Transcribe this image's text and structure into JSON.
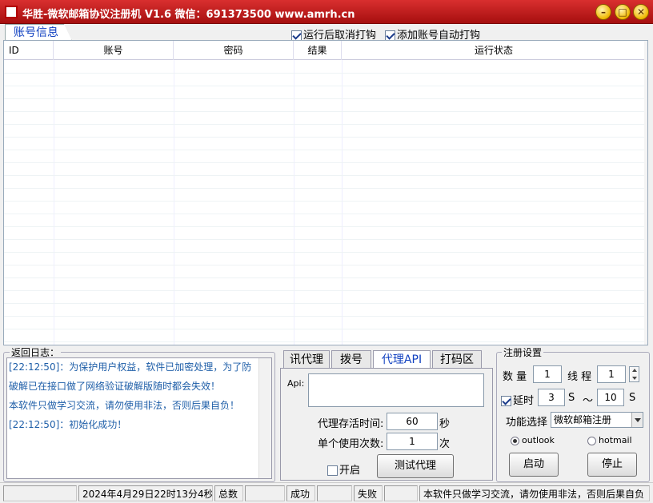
{
  "window": {
    "title": "华胜-微软邮箱协议注册机 V1.6  微信：691373500  www.amrh.cn",
    "minimize": "–",
    "maximize": "□",
    "close": "✕"
  },
  "tabs": {
    "account_info": "账号信息"
  },
  "options": {
    "uncheck_after_run": {
      "label": "运行后取消打钩",
      "checked": true
    },
    "auto_check_new": {
      "label": "添加账号自动打钩",
      "checked": true
    }
  },
  "table": {
    "columns": [
      "ID",
      "账号",
      "密码",
      "结果",
      "运行状态"
    ],
    "rows": []
  },
  "log": {
    "title": "返回日志：",
    "lines": [
      "[22:12:50]：为保护用户权益，软件已加密处理，为了防",
      "破解已在接口做了网络验证破解版随时都会失效！",
      "本软件只做学习交流，请勿使用非法，否则后果自负！",
      "[22:12:50]：初始化成功！"
    ]
  },
  "proxy_tabs": [
    "讯代理",
    "拨号",
    "代理API",
    "打码区"
  ],
  "proxy": {
    "api_label": "Api:",
    "api_value": "",
    "alive_time_label": "代理存活时间:",
    "alive_time_value": "60",
    "alive_time_unit": "秒",
    "use_count_label": "单个使用次数:",
    "use_count_value": "1",
    "use_count_unit": "次",
    "enable_label": "开启",
    "enable_checked": false,
    "test_button": "测试代理"
  },
  "register": {
    "title": "注册设置",
    "count_label": "数 量",
    "count_value": "1",
    "thread_label": "线 程",
    "thread_value": "1",
    "delay_label": "延时",
    "delay_checked": true,
    "delay_min": "3",
    "delay_min_unit": "S",
    "delay_sep": "～",
    "delay_max": "10",
    "delay_max_unit": "S",
    "function_label": "功能选择",
    "function_value": "微软邮箱注册",
    "radio_outlook": "outlook",
    "radio_hotmail": "hotmail",
    "selected": "outlook",
    "start_button": "启动",
    "stop_button": "停止"
  },
  "status": {
    "datetime": "2024年4月29日22时13分4秒",
    "total_label": "总数",
    "total_value": "",
    "success_label": "成功",
    "success_value": "",
    "fail_label": "失败",
    "fail_value": "",
    "notice": "本软件只做学习交流，请勿使用非法，否则后果自负"
  },
  "colors": {
    "titlebar": "#c41c1c",
    "accent_blue": "#1040c0",
    "log_text": "#1e5ea8"
  }
}
